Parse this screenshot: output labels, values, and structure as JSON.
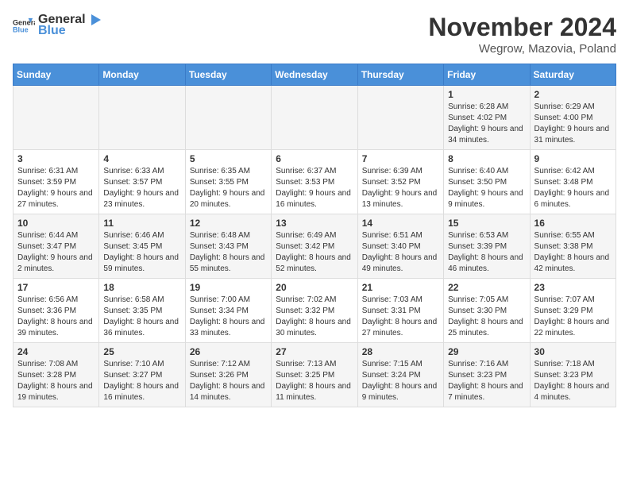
{
  "header": {
    "logo_general": "General",
    "logo_blue": "Blue",
    "month_year": "November 2024",
    "location": "Wegrow, Mazovia, Poland"
  },
  "days_of_week": [
    "Sunday",
    "Monday",
    "Tuesday",
    "Wednesday",
    "Thursday",
    "Friday",
    "Saturday"
  ],
  "weeks": [
    [
      {
        "day": "",
        "info": ""
      },
      {
        "day": "",
        "info": ""
      },
      {
        "day": "",
        "info": ""
      },
      {
        "day": "",
        "info": ""
      },
      {
        "day": "",
        "info": ""
      },
      {
        "day": "1",
        "info": "Sunrise: 6:28 AM\nSunset: 4:02 PM\nDaylight: 9 hours and 34 minutes."
      },
      {
        "day": "2",
        "info": "Sunrise: 6:29 AM\nSunset: 4:00 PM\nDaylight: 9 hours and 31 minutes."
      }
    ],
    [
      {
        "day": "3",
        "info": "Sunrise: 6:31 AM\nSunset: 3:59 PM\nDaylight: 9 hours and 27 minutes."
      },
      {
        "day": "4",
        "info": "Sunrise: 6:33 AM\nSunset: 3:57 PM\nDaylight: 9 hours and 23 minutes."
      },
      {
        "day": "5",
        "info": "Sunrise: 6:35 AM\nSunset: 3:55 PM\nDaylight: 9 hours and 20 minutes."
      },
      {
        "day": "6",
        "info": "Sunrise: 6:37 AM\nSunset: 3:53 PM\nDaylight: 9 hours and 16 minutes."
      },
      {
        "day": "7",
        "info": "Sunrise: 6:39 AM\nSunset: 3:52 PM\nDaylight: 9 hours and 13 minutes."
      },
      {
        "day": "8",
        "info": "Sunrise: 6:40 AM\nSunset: 3:50 PM\nDaylight: 9 hours and 9 minutes."
      },
      {
        "day": "9",
        "info": "Sunrise: 6:42 AM\nSunset: 3:48 PM\nDaylight: 9 hours and 6 minutes."
      }
    ],
    [
      {
        "day": "10",
        "info": "Sunrise: 6:44 AM\nSunset: 3:47 PM\nDaylight: 9 hours and 2 minutes."
      },
      {
        "day": "11",
        "info": "Sunrise: 6:46 AM\nSunset: 3:45 PM\nDaylight: 8 hours and 59 minutes."
      },
      {
        "day": "12",
        "info": "Sunrise: 6:48 AM\nSunset: 3:43 PM\nDaylight: 8 hours and 55 minutes."
      },
      {
        "day": "13",
        "info": "Sunrise: 6:49 AM\nSunset: 3:42 PM\nDaylight: 8 hours and 52 minutes."
      },
      {
        "day": "14",
        "info": "Sunrise: 6:51 AM\nSunset: 3:40 PM\nDaylight: 8 hours and 49 minutes."
      },
      {
        "day": "15",
        "info": "Sunrise: 6:53 AM\nSunset: 3:39 PM\nDaylight: 8 hours and 46 minutes."
      },
      {
        "day": "16",
        "info": "Sunrise: 6:55 AM\nSunset: 3:38 PM\nDaylight: 8 hours and 42 minutes."
      }
    ],
    [
      {
        "day": "17",
        "info": "Sunrise: 6:56 AM\nSunset: 3:36 PM\nDaylight: 8 hours and 39 minutes."
      },
      {
        "day": "18",
        "info": "Sunrise: 6:58 AM\nSunset: 3:35 PM\nDaylight: 8 hours and 36 minutes."
      },
      {
        "day": "19",
        "info": "Sunrise: 7:00 AM\nSunset: 3:34 PM\nDaylight: 8 hours and 33 minutes."
      },
      {
        "day": "20",
        "info": "Sunrise: 7:02 AM\nSunset: 3:32 PM\nDaylight: 8 hours and 30 minutes."
      },
      {
        "day": "21",
        "info": "Sunrise: 7:03 AM\nSunset: 3:31 PM\nDaylight: 8 hours and 27 minutes."
      },
      {
        "day": "22",
        "info": "Sunrise: 7:05 AM\nSunset: 3:30 PM\nDaylight: 8 hours and 25 minutes."
      },
      {
        "day": "23",
        "info": "Sunrise: 7:07 AM\nSunset: 3:29 PM\nDaylight: 8 hours and 22 minutes."
      }
    ],
    [
      {
        "day": "24",
        "info": "Sunrise: 7:08 AM\nSunset: 3:28 PM\nDaylight: 8 hours and 19 minutes."
      },
      {
        "day": "25",
        "info": "Sunrise: 7:10 AM\nSunset: 3:27 PM\nDaylight: 8 hours and 16 minutes."
      },
      {
        "day": "26",
        "info": "Sunrise: 7:12 AM\nSunset: 3:26 PM\nDaylight: 8 hours and 14 minutes."
      },
      {
        "day": "27",
        "info": "Sunrise: 7:13 AM\nSunset: 3:25 PM\nDaylight: 8 hours and 11 minutes."
      },
      {
        "day": "28",
        "info": "Sunrise: 7:15 AM\nSunset: 3:24 PM\nDaylight: 8 hours and 9 minutes."
      },
      {
        "day": "29",
        "info": "Sunrise: 7:16 AM\nSunset: 3:23 PM\nDaylight: 8 hours and 7 minutes."
      },
      {
        "day": "30",
        "info": "Sunrise: 7:18 AM\nSunset: 3:23 PM\nDaylight: 8 hours and 4 minutes."
      }
    ]
  ]
}
